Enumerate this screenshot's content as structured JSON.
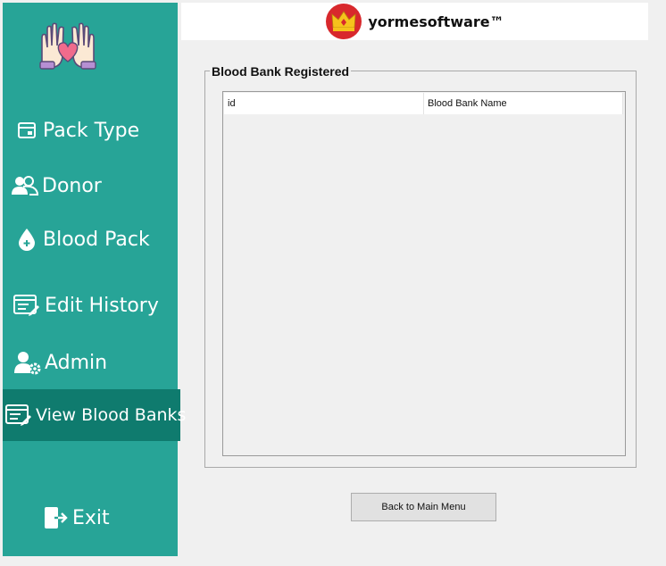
{
  "sidebar": {
    "logo_icon": "hands-heart-icon",
    "items": [
      {
        "label": "Pack Type",
        "icon": "pack-icon"
      },
      {
        "label": "Donor",
        "icon": "users-icon"
      },
      {
        "label": "Blood Pack",
        "icon": "blood-drop-icon"
      },
      {
        "label": "Edit History",
        "icon": "edit-list-icon"
      },
      {
        "label": "Admin",
        "icon": "admin-gear-icon"
      },
      {
        "label": "View Blood Banks",
        "icon": "list-icon"
      },
      {
        "label": "Exit",
        "icon": "exit-icon"
      }
    ],
    "active_item": "View Blood Banks",
    "colors": {
      "bg": "#27a497",
      "active": "#0f7b6e"
    }
  },
  "header": {
    "brand": "yormesoftware™",
    "logo_icon": "crown-logo-icon"
  },
  "main": {
    "group_title": "Blood Bank Registered",
    "table": {
      "columns": [
        "id",
        "Blood Bank Name"
      ],
      "rows": []
    },
    "back_button": "Back to Main Menu"
  }
}
